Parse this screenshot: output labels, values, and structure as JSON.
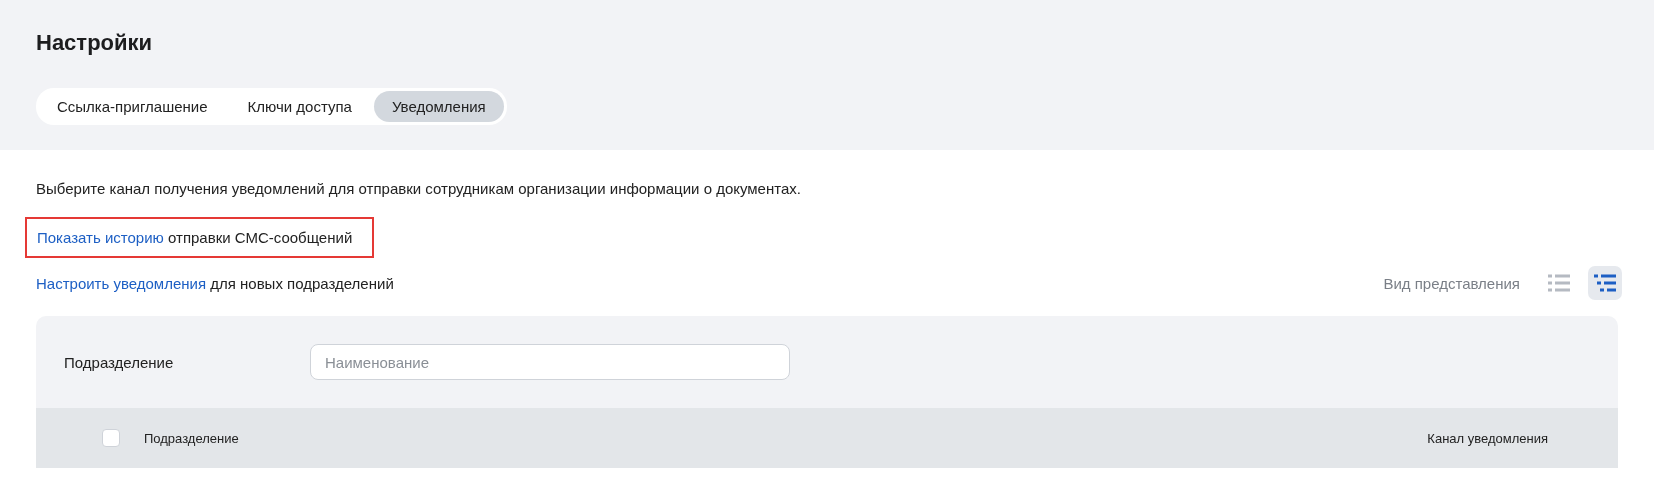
{
  "page_title": "Настройки",
  "tabs": [
    {
      "label": "Ссылка-приглашение",
      "selected": false
    },
    {
      "label": "Ключи доступа",
      "selected": false
    },
    {
      "label": "Уведомления",
      "selected": true
    }
  ],
  "description": "Выберите канал получения уведомлений для отправки сотрудникам организации информации о документах.",
  "history_line": {
    "link": "Показать историю",
    "text": "отправки СМС-сообщений",
    "highlighted": true
  },
  "settings_line": {
    "link": "Настроить уведомления",
    "text": "для новых подразделений"
  },
  "view": {
    "label": "Вид представления",
    "modes": [
      {
        "kind": "list",
        "selected": false
      },
      {
        "kind": "tree",
        "selected": true
      }
    ]
  },
  "filter": {
    "label": "Подразделение",
    "placeholder": "Наименование"
  },
  "table": {
    "select_all_checked": false,
    "columns": [
      "Подразделение",
      "Канал уведомления"
    ]
  }
}
